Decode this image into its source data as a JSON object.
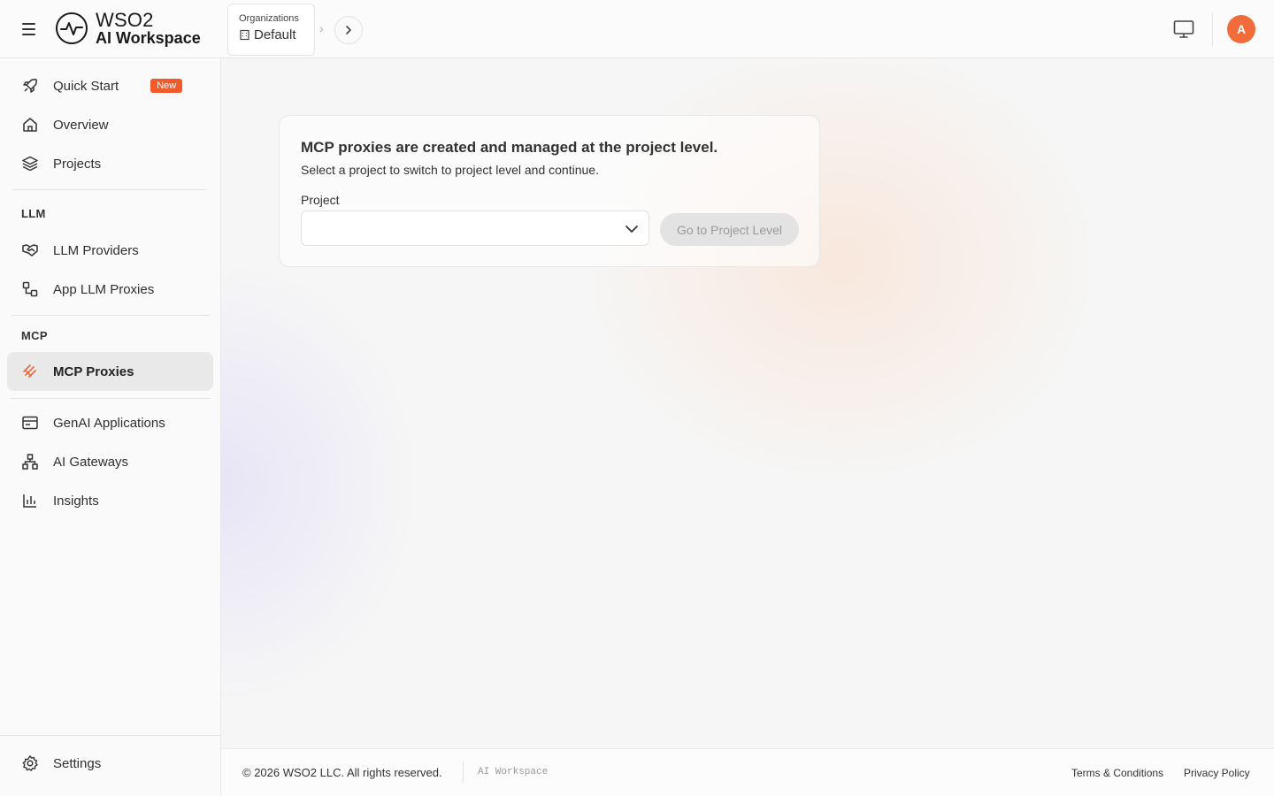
{
  "header": {
    "logo_line1": "WSO2",
    "logo_line2": "AI Workspace",
    "org_label": "Organizations",
    "org_value": "Default",
    "avatar_initial": "A"
  },
  "sidebar": {
    "items_top": [
      {
        "label": "Quick Start",
        "icon": "rocket-icon",
        "badge": "New"
      },
      {
        "label": "Overview",
        "icon": "home-icon"
      },
      {
        "label": "Projects",
        "icon": "layers-icon"
      }
    ],
    "llm_section": "LLM",
    "llm_items": [
      {
        "label": "LLM Providers",
        "icon": "handshake-icon"
      },
      {
        "label": "App LLM Proxies",
        "icon": "proxy-icon"
      }
    ],
    "mcp_section": "MCP",
    "mcp_items": [
      {
        "label": "MCP Proxies",
        "icon": "mcp-icon",
        "active": true
      }
    ],
    "items_bottom": [
      {
        "label": "GenAI Applications",
        "icon": "app-window-icon"
      },
      {
        "label": "AI Gateways",
        "icon": "network-icon"
      },
      {
        "label": "Insights",
        "icon": "bar-chart-icon"
      }
    ],
    "settings": "Settings"
  },
  "main": {
    "title": "MCP proxies are created and managed at the project level.",
    "subtitle": "Select a project to switch to project level and continue.",
    "project_label": "Project",
    "project_value": "",
    "go_button": "Go to Project Level"
  },
  "footer": {
    "copyright": "© 2026 WSO2 LLC. All rights reserved.",
    "brand": "AI Workspace",
    "terms": "Terms & Conditions",
    "privacy": "Privacy Policy"
  },
  "colors": {
    "accent": "#f26b3a",
    "badge": "#f15b2a",
    "active_bg": "#e9e9e9"
  }
}
